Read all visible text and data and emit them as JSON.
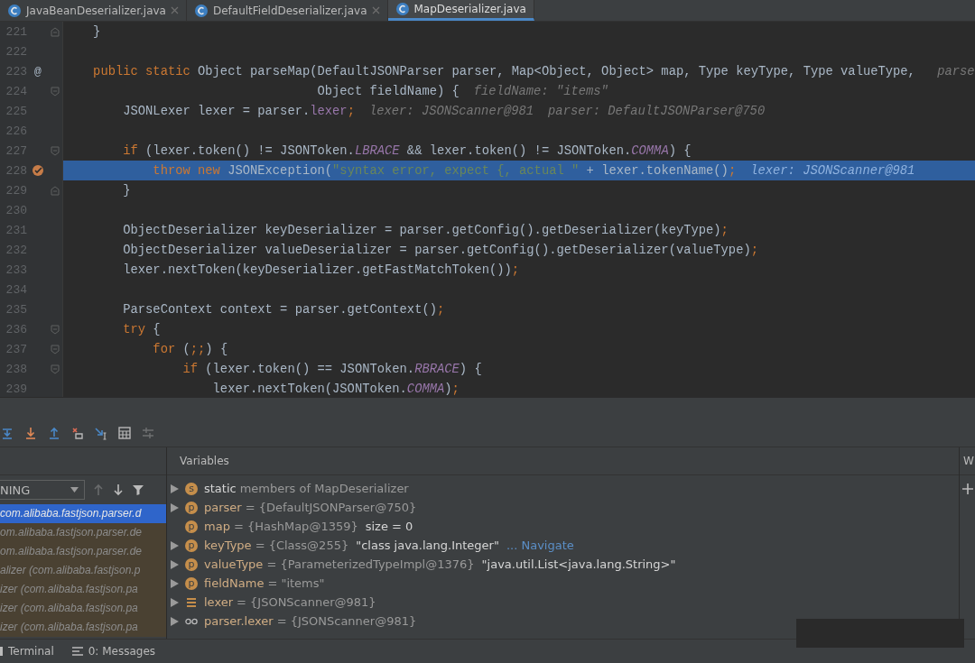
{
  "tabs": [
    {
      "label": "JavaBeanDeserializer.java",
      "selected": false,
      "closable": true
    },
    {
      "label": "DefaultFieldDeserializer.java",
      "selected": false,
      "closable": true
    },
    {
      "label": "MapDeserializer.java",
      "selected": true,
      "closable": false
    }
  ],
  "editor": {
    "lines": [
      {
        "number": "221",
        "kind": "fold-end",
        "current": false,
        "segments": [
          {
            "kind": "plain",
            "text": "    }"
          }
        ]
      },
      {
        "number": "222",
        "kind": "plain",
        "current": false
      },
      {
        "number": "223",
        "kind": "override",
        "gutter_text": "@",
        "current": false,
        "segments": [
          {
            "kind": "kw",
            "text": "    public static "
          },
          {
            "kind": "plain",
            "text": "Object parseMap(DefaultJSONParser parser, Map<Object, Object> map, Type keyType, Type valueType, "
          }
        ],
        "hints": [
          "parse"
        ]
      },
      {
        "number": "224",
        "kind": "fold-start",
        "current": false,
        "segments": [
          {
            "kind": "plain",
            "text": "                                  Object fieldName) {"
          }
        ],
        "hints": [
          "fieldName: \"items\""
        ]
      },
      {
        "number": "225",
        "kind": "plain",
        "current": false,
        "segments": [
          {
            "kind": "plain",
            "text": "        JSONLexer lexer = parser."
          },
          {
            "kind": "field",
            "text": "lexer"
          },
          {
            "kind": "kw",
            "text": ";"
          }
        ],
        "hints": [
          "lexer: JSONScanner@981",
          "parser: DefaultJSONParser@750"
        ]
      },
      {
        "number": "226",
        "kind": "plain",
        "current": false
      },
      {
        "number": "227",
        "kind": "fold-start",
        "current": false,
        "segments": [
          {
            "kind": "kw",
            "text": "        if"
          },
          {
            "kind": "plain",
            "text": " (lexer.token() != JSONToken."
          },
          {
            "kind": "const",
            "text": "LBRACE"
          },
          {
            "kind": "plain",
            "text": " && lexer.token() != JSONToken."
          },
          {
            "kind": "const",
            "text": "COMMA"
          },
          {
            "kind": "plain",
            "text": ") {"
          }
        ]
      },
      {
        "number": "228",
        "kind": "breakpoint",
        "current": true,
        "segments": [
          {
            "kind": "kw",
            "text": "            throw new"
          },
          {
            "kind": "plain",
            "text": " JSONException("
          },
          {
            "kind": "str",
            "text": "\"syntax error, expect {, actual \""
          },
          {
            "kind": "plain",
            "text": " + lexer.tokenName()"
          },
          {
            "kind": "kw",
            "text": ";"
          }
        ],
        "hints": [
          "lexer: JSONScanner@981"
        ]
      },
      {
        "number": "229",
        "kind": "fold-end",
        "current": false,
        "segments": [
          {
            "kind": "plain",
            "text": "        }"
          }
        ]
      },
      {
        "number": "230",
        "kind": "plain",
        "current": false
      },
      {
        "number": "231",
        "kind": "plain",
        "current": false,
        "segments": [
          {
            "kind": "plain",
            "text": "        ObjectDeserializer keyDeserializer = parser.getConfig().getDeserializer(keyType)"
          },
          {
            "kind": "kw",
            "text": ";"
          }
        ]
      },
      {
        "number": "232",
        "kind": "plain",
        "current": false,
        "segments": [
          {
            "kind": "plain",
            "text": "        ObjectDeserializer valueDeserializer = parser.getConfig().getDeserializer(valueType)"
          },
          {
            "kind": "kw",
            "text": ";"
          }
        ]
      },
      {
        "number": "233",
        "kind": "plain",
        "current": false,
        "segments": [
          {
            "kind": "plain",
            "text": "        lexer.nextToken(keyDeserializer.getFastMatchToken())"
          },
          {
            "kind": "kw",
            "text": ";"
          }
        ]
      },
      {
        "number": "234",
        "kind": "plain",
        "current": false
      },
      {
        "number": "235",
        "kind": "plain",
        "current": false,
        "segments": [
          {
            "kind": "plain",
            "text": "        ParseContext context = parser.getContext()"
          },
          {
            "kind": "kw",
            "text": ";"
          }
        ]
      },
      {
        "number": "236",
        "kind": "fold-start",
        "current": false,
        "segments": [
          {
            "kind": "kw",
            "text": "        try"
          },
          {
            "kind": "plain",
            "text": " {"
          }
        ]
      },
      {
        "number": "237",
        "kind": "fold-start",
        "current": false,
        "segments": [
          {
            "kind": "kw",
            "text": "            for"
          },
          {
            "kind": "plain",
            "text": " ("
          },
          {
            "kind": "kw",
            "text": ";;"
          },
          {
            "kind": "plain",
            "text": ") {"
          }
        ]
      },
      {
        "number": "238",
        "kind": "fold-start",
        "current": false,
        "segments": [
          {
            "kind": "kw",
            "text": "                if"
          },
          {
            "kind": "plain",
            "text": " (lexer.token() == JSONToken."
          },
          {
            "kind": "const",
            "text": "RBRACE"
          },
          {
            "kind": "plain",
            "text": ") {"
          }
        ]
      },
      {
        "number": "239",
        "kind": "plain",
        "current": false,
        "segments": [
          {
            "kind": "plain",
            "text": "                    lexer.nextToken(JSONToken."
          },
          {
            "kind": "const",
            "text": "COMMA"
          },
          {
            "kind": "plain",
            "text": ")"
          },
          {
            "kind": "kw",
            "text": ";"
          }
        ]
      }
    ]
  },
  "debugger": {
    "toolbar": [
      {
        "kind": "step-over",
        "disabled": false
      },
      {
        "kind": "step-into",
        "disabled": false
      },
      {
        "kind": "step-out",
        "disabled": false
      },
      {
        "kind": "drop-frame",
        "disabled": false
      },
      {
        "kind": "run-to-cursor",
        "disabled": false
      },
      {
        "kind": "evaluate",
        "disabled": false
      },
      {
        "kind": "trace",
        "disabled": true
      }
    ],
    "frames": {
      "thread_dropdown": "NING",
      "up_disabled": true,
      "items": [
        {
          "text": "com.alibaba.fastjson.parser.d",
          "selected": true,
          "library": false
        },
        {
          "text": "om.alibaba.fastjson.parser.de",
          "selected": false,
          "library": true
        },
        {
          "text": "om.alibaba.fastjson.parser.de",
          "selected": false,
          "library": true
        },
        {
          "text": "alizer (com.alibaba.fastjson.p",
          "selected": false,
          "library": true
        },
        {
          "text": "izer (com.alibaba.fastjson.pa",
          "selected": false,
          "library": true
        },
        {
          "text": "izer (com.alibaba.fastjson.pa",
          "selected": false,
          "library": true
        },
        {
          "text": "izer (com.alibaba.fastjson.pa",
          "selected": false,
          "library": true
        }
      ]
    },
    "variables": {
      "title": "Variables",
      "rows": [
        {
          "kind": "static",
          "icon_text": "s",
          "expandable": true,
          "name": "static",
          "value": "members of MapDeserializer"
        },
        {
          "kind": "param",
          "icon_text": "p",
          "expandable": true,
          "name": "parser",
          "value": "= {DefaultJSONParser@750}"
        },
        {
          "kind": "param",
          "icon_text": "p",
          "expandable": false,
          "name": "map",
          "value": "= {HashMap@1359}",
          "extra": "size = 0"
        },
        {
          "kind": "param",
          "icon_text": "p",
          "expandable": true,
          "name": "keyType",
          "value": "= {Class@255}",
          "extra": "\"class java.lang.Integer\"",
          "link": "... Navigate"
        },
        {
          "kind": "param",
          "icon_text": "p",
          "expandable": true,
          "name": "valueType",
          "value": "= {ParameterizedTypeImpl@1376}",
          "extra": "\"java.util.List<java.lang.String>\""
        },
        {
          "kind": "param",
          "icon_text": "p",
          "expandable": true,
          "name": "fieldName",
          "value": "= \"items\""
        },
        {
          "kind": "field",
          "expandable": true,
          "name": "lexer",
          "value": "= {JSONScanner@981}"
        },
        {
          "kind": "watch",
          "expandable": true,
          "name": "parser.lexer",
          "value": "= {JSONScanner@981}"
        }
      ]
    },
    "watches": {
      "title": "W"
    }
  },
  "status_bar": [
    {
      "kind": "terminal",
      "label": "Terminal"
    },
    {
      "kind": "messages",
      "label": "0: Messages"
    }
  ]
}
